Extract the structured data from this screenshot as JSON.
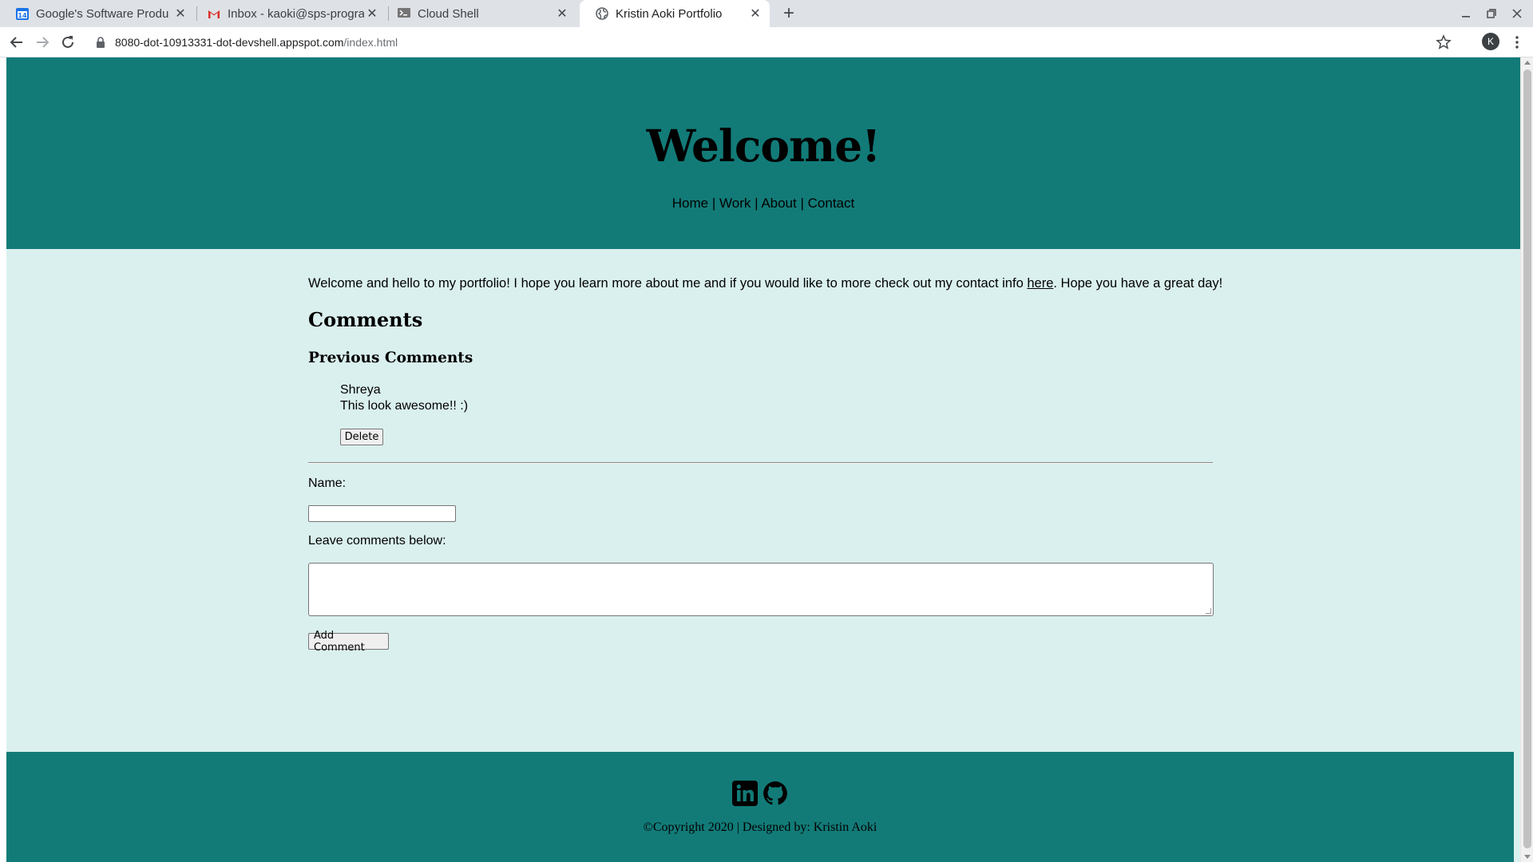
{
  "browser": {
    "tabs": [
      {
        "title": "Google's Software Produ",
        "icon": "calendar-icon"
      },
      {
        "title": "Inbox - kaoki@sps-progra",
        "icon": "gmail-icon"
      },
      {
        "title": "Cloud Shell",
        "icon": "cloud-shell-icon"
      },
      {
        "title": "Kristin Aoki Portfolio",
        "icon": "globe-icon",
        "active": true
      }
    ],
    "calendar_day": "14",
    "url_host": "8080-dot-10913331-dot-devshell.appspot.com",
    "url_path": "/index.html",
    "profile_initial": "K"
  },
  "header": {
    "title": "Welcome!",
    "nav": [
      "Home",
      "Work",
      "About",
      "Contact"
    ],
    "nav_separator": "|"
  },
  "main": {
    "intro_before": "Welcome and hello to my portfolio! I hope you learn more about me and if you would like to more check out my contact info ",
    "intro_link": "here",
    "intro_after": ". Hope you have a great day!",
    "comments_heading": "Comments",
    "previous_heading": "Previous Comments",
    "comments": [
      {
        "name": "Shreya",
        "text": "This look awesome!! :)",
        "delete_label": "Delete"
      }
    ],
    "form": {
      "name_label": "Name:",
      "name_value": "",
      "comment_label": "Leave comments below:",
      "comment_value": "",
      "submit_label": "Add Comment"
    }
  },
  "footer": {
    "social": [
      "linkedin-icon",
      "github-icon"
    ],
    "copyright": "©Copyright 2020 | Designed by: Kristin Aoki"
  },
  "colors": {
    "header_bg": "#127b78",
    "page_bg": "#daf0ee",
    "footer_bg": "#127b78"
  }
}
